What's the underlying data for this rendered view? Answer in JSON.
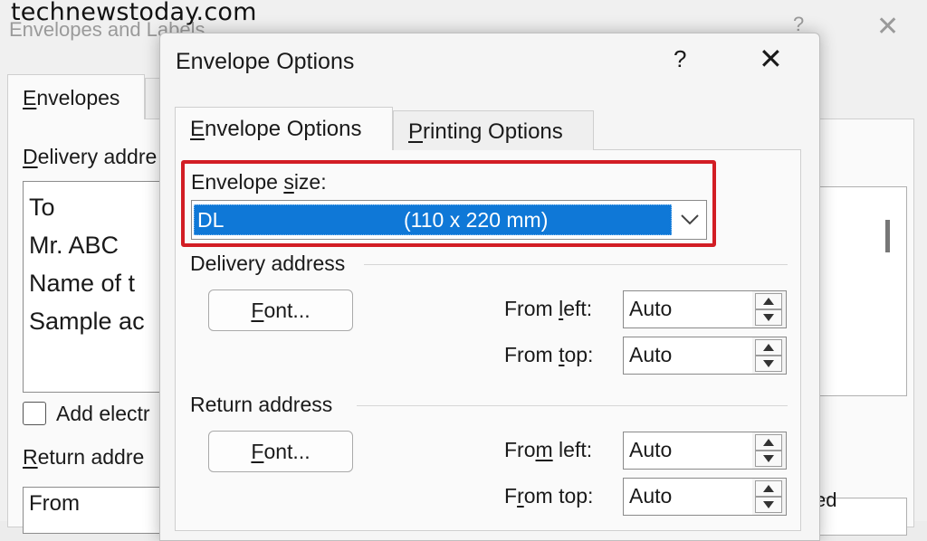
{
  "watermark": "technewstoday.com",
  "background_dialog": {
    "title": "Envelopes and Labels",
    "help": "?",
    "close": "✕",
    "tab_label_first": "E",
    "tab_label_rest": "nvelopes",
    "delivery_label_first": "D",
    "delivery_label_rest": "elivery addre",
    "address_lines": [
      "To",
      "Mr. ABC",
      "Name of t",
      "Sample ac"
    ],
    "add_electronic": "Add electr",
    "return_label_first": "R",
    "return_label_rest": "eturn addre",
    "return_value": "From",
    "right_partial": "ed"
  },
  "dialog": {
    "title": "Envelope Options",
    "help": "?",
    "close": "✕",
    "tabs": {
      "envelope_options_first": "E",
      "envelope_options_rest": "nvelope Options",
      "printing_options_first": "P",
      "printing_options_rest": "rinting Options"
    },
    "envelope_size_label_pre": "Envelope ",
    "envelope_size_label_ul": "s",
    "envelope_size_label_post": "ize:",
    "envelope_size_code": "DL",
    "envelope_size_dims": "(110 x 220 mm)",
    "delivery_section": "Delivery address",
    "return_section": "Return address",
    "font_button_first": "F",
    "font_button_rest": "ont...",
    "delivery_from_left_pre": "From ",
    "delivery_from_left_ul": "l",
    "delivery_from_left_post": "eft:",
    "delivery_from_top_pre": "From ",
    "delivery_from_top_ul": "t",
    "delivery_from_top_post": "op:",
    "return_from_left_pre": "Fro",
    "return_from_left_ul": "m",
    "return_from_left_post": " left:",
    "return_from_top_pre": "F",
    "return_from_top_ul": "r",
    "return_from_top_post": "om top:",
    "delivery_from_left_value": "Auto",
    "delivery_from_top_value": "Auto",
    "return_from_left_value": "Auto",
    "return_from_top_value": "Auto"
  },
  "colors": {
    "highlight": "#d21d24",
    "selection": "#0f78d7"
  },
  "icons": [
    "chevron-down-icon",
    "spin-up-icon",
    "spin-down-icon",
    "close-icon",
    "help-icon"
  ]
}
